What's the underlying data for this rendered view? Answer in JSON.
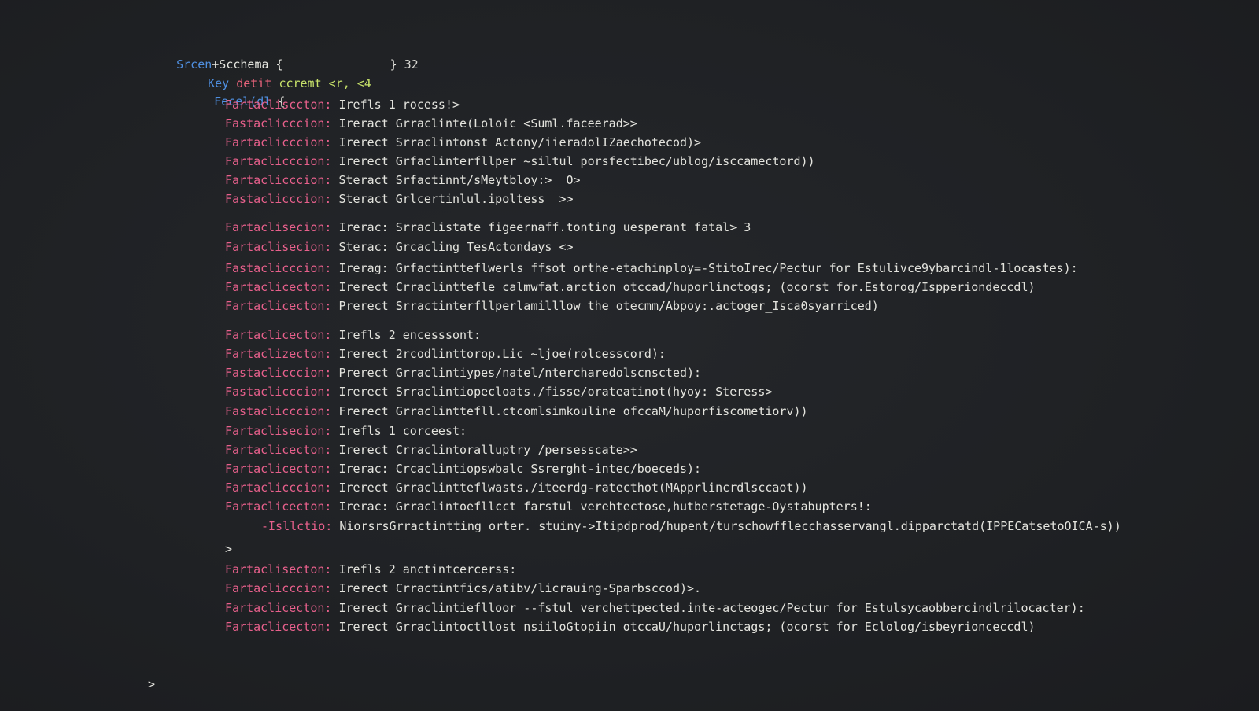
{
  "header": {
    "schema_prefix": "Srcen",
    "schema_name": "+Scchema {",
    "schema_close": "}",
    "schema_count": "32"
  },
  "key_line": {
    "key": "Key",
    "kw": "detit",
    "rest": "ccremt <r, <4"
  },
  "field_line": {
    "name": "Fecel(dl",
    "brace": "{"
  },
  "lines": [
    {
      "label": "Fartaclisccton:",
      "body": "Irefls 1 rocess!>"
    },
    {
      "label": "Fastaclicccion:",
      "body": "Ireract Grraclinte(Loloic <Suml.faceerad>>"
    },
    {
      "label": "Fartaclicccion:",
      "body": "Irerect Srraclintonst Actony/iieradolIZaechotecod)>"
    },
    {
      "label": "Fartaclicccion:",
      "body": "Irerect Grfaclinterfllper ~siltul porsfectibec/ublog/isccamectord))"
    },
    {
      "label": "Fartaclicccion:",
      "body": "Steract Srfactinnt/sMeytbloy:>  O>"
    },
    {
      "label": "Fastaclicccion:",
      "body": "Steract Grlcertinlul.ipoltess  >>"
    },
    {
      "label": "Fartaclisecion:",
      "body": "Irerac: Srraclistate_figeernaff.tonting uesperant fatal> 3"
    },
    {
      "label": "Fartaclisecion:",
      "body": "Sterac: Grcacling TesActondays <>"
    },
    {
      "label": "Fastaclicccion:",
      "body": "Irerag: Grfactintteflwerls ffsot orthe-etachinploy=-StitoIrec/Pectur for Estulivce9ybarcindl-1locastes):"
    },
    {
      "label": "Fartaclicecton:",
      "body": "Irerect Crraclinttefle calmwfat.arction otccad/huporlinctogs; (ocorst for.Estorog/Ispperiondeccdl)"
    },
    {
      "label": "Fartaclicecton:",
      "body": "Prerect Srractinterfllperlamilllow the otecmm/Abpoy:.actoger_Isca0syarriced)"
    },
    {
      "label": "Fartaclicecton:",
      "body": "Irefls 2 encesssont:"
    },
    {
      "label": "Fartaclizecton:",
      "body": "Irerect 2rcodlinttorop.Lic ~ljoe(rolcesscord):"
    },
    {
      "label": "Fastaclicccion:",
      "body": "Prerect Grraclintiypes/natel/ntercharedolscnscted):"
    },
    {
      "label": "Fastaclicccion:",
      "body": "Irerect Srraclintiopecloats./fisse/orateatinot(hyoy: Steress>"
    },
    {
      "label": "Fastaclicccion:",
      "body": "Frerect Grraclinttefll.ctcomlsimkouline ofccaM/huporfiscometiorv))"
    },
    {
      "label": "Fartaclisecion:",
      "body": "Irefls 1 corceest:"
    },
    {
      "label": "Fartaclicecton:",
      "body": "Irerect Crraclintoralluptry /persesscate>>"
    },
    {
      "label": "Fartaclicecton:",
      "body": "Irerac: Crcaclintiopswbalc Ssrerght-intec/boeceds):"
    },
    {
      "label": "Fartaclicccion:",
      "body": "Irerect Grraclintteflwasts./iteerdg-ratecthot(MApprlincrdlsccaot))"
    },
    {
      "label": "Fartaclicecton:",
      "body": "Irerac: Grraclintoefllcct farstul verehtectose,hutberstetage-Oystabupters!:"
    },
    {
      "label": "-Isllctio:",
      "body": "NiorsrsGrractintting orter. stuiny->Itipdprod/hupent/turschowfflecchasservangl.dipparctatd(IPPECatsetoOICA-s))"
    },
    {
      "label": "Fartaclisecton:",
      "body": "Irefls 2 anctintcercerss:"
    },
    {
      "label": "Fartaclicccion:",
      "body": "Irerect Crractintfics/atibv/licrauing-Sparbsccod)>."
    },
    {
      "label": "Fartaclicecton:",
      "body": "Irerect Grraclintieflloor --fstul verchettpected.inte-acteogec/Pectur for Estulsycaobbercindlrilocacter):"
    },
    {
      "label": "Fartaclicecton:",
      "body": "Irerect Grraclintoctllost nsiiloGtopiin otccaU/huporlinctags; (ocorst for Eclolog/isbeyrionceccdl)"
    }
  ],
  "inner_close": ">",
  "outer_close": ">"
}
